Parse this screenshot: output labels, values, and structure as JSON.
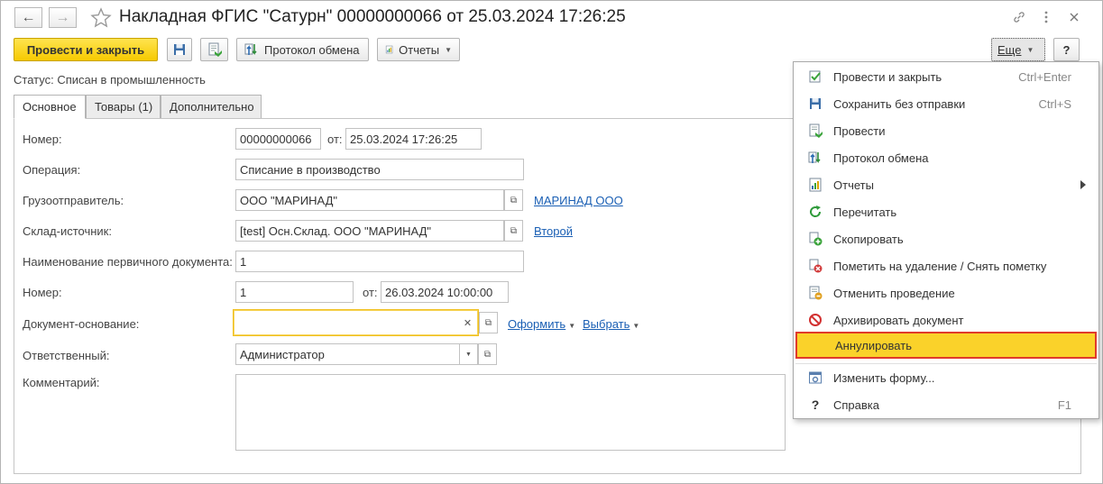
{
  "window": {
    "title": "Накладная ФГИС \"Сатурн\" 00000000066 от 25.03.2024 17:26:25",
    "back_symbol": "←",
    "forward_symbol": "→"
  },
  "toolbar": {
    "post_and_close": "Провести и закрыть",
    "exchange_log": "Протокол обмена",
    "reports": "Отчеты",
    "more": "Еще",
    "help": "?"
  },
  "status": {
    "label": "Статус:",
    "value": "Списан в промышленность"
  },
  "tabs": [
    {
      "label": "Основное",
      "active": true
    },
    {
      "label": "Товары (1)",
      "active": false
    },
    {
      "label": "Дополнительно",
      "active": false
    }
  ],
  "form": {
    "number_label": "Номер:",
    "number_value": "00000000066",
    "from_label": "от:",
    "date_value": "25.03.2024 17:26:25",
    "operation_label": "Операция:",
    "operation_value": "Списание в производство",
    "shipper_label": "Грузоотправитель:",
    "shipper_value": "ООО \"МАРИНАД\"",
    "shipper_link": "МАРИНАД ООО",
    "warehouse_label": "Склад-источник:",
    "warehouse_value": "[test] Осн.Склад. ООО \"МАРИНАД\"",
    "warehouse_link": "Второй",
    "primary_doc_label": "Наименование первичного документа:",
    "primary_doc_value": "1",
    "primary_num_label": "Номер:",
    "primary_num_value": "1",
    "primary_from_label": "от:",
    "primary_date_value": "26.03.2024 10:00:00",
    "basis_label": "Документ-основание:",
    "basis_value": "",
    "basis_link_issue": "Оформить",
    "basis_link_select": "Выбрать",
    "responsible_label": "Ответственный:",
    "responsible_value": "Администратор",
    "comment_label": "Комментарий:",
    "comment_value": ""
  },
  "menu": {
    "items": [
      {
        "label": "Провести и закрыть",
        "shortcut": "Ctrl+Enter",
        "icon": "post-close-icon"
      },
      {
        "label": "Сохранить без отправки",
        "shortcut": "Ctrl+S",
        "icon": "save-icon"
      },
      {
        "label": "Провести",
        "shortcut": "",
        "icon": "post-icon"
      },
      {
        "label": "Протокол обмена",
        "shortcut": "",
        "icon": "exchange-icon"
      },
      {
        "label": "Отчеты",
        "shortcut": "",
        "icon": "reports-icon"
      },
      {
        "label": "Перечитать",
        "shortcut": "",
        "icon": "refresh-icon"
      },
      {
        "label": "Скопировать",
        "shortcut": "",
        "icon": "copy-icon"
      },
      {
        "label": "Пометить на удаление / Снять пометку",
        "shortcut": "",
        "icon": "mark-delete-icon"
      },
      {
        "label": "Отменить проведение",
        "shortcut": "",
        "icon": "cancel-post-icon"
      },
      {
        "label": "Архивировать документ",
        "shortcut": "",
        "icon": "archive-icon"
      },
      {
        "label": "Аннулировать",
        "shortcut": "",
        "icon": "annul-icon"
      },
      {
        "label": "Изменить форму...",
        "shortcut": "",
        "icon": "change-form-icon"
      },
      {
        "label": "Справка",
        "shortcut": "F1",
        "icon": "help-icon"
      }
    ]
  },
  "colors": {
    "primary_button": "#f6c900",
    "link": "#1a5fb4",
    "highlight": "#fad22a",
    "highlight_border": "#e03a2a"
  }
}
